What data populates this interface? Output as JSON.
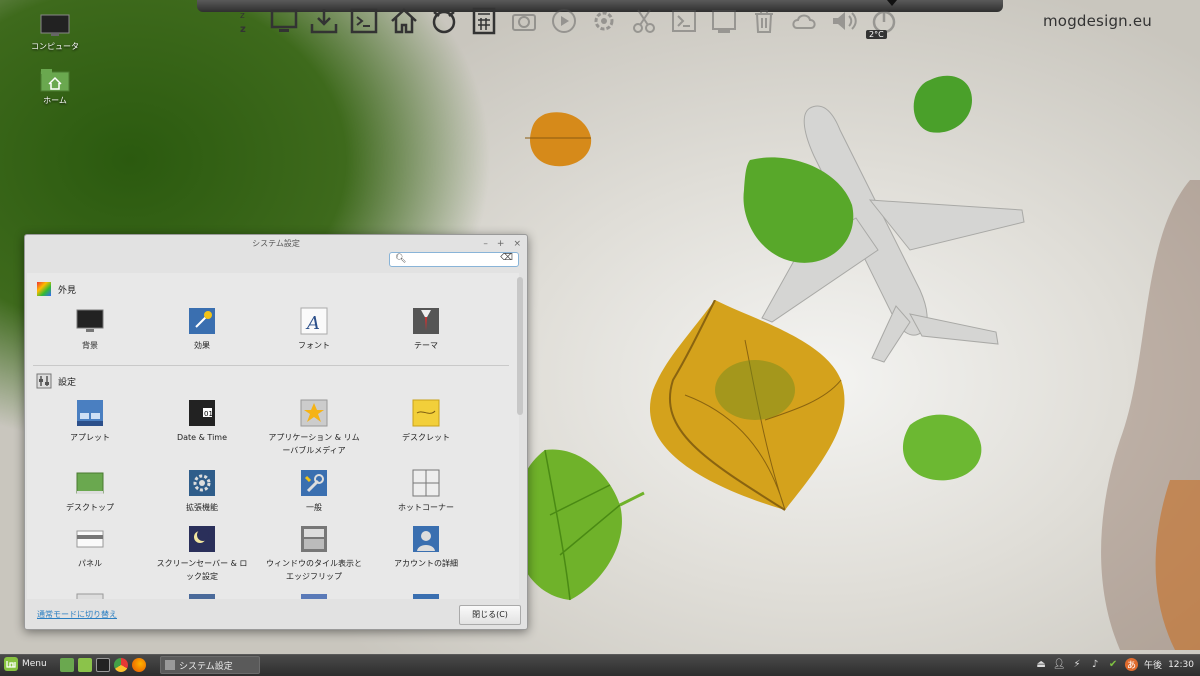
{
  "desktop": {
    "brand": "mogdesign.eu",
    "icons": [
      {
        "label": "コンピュータ",
        "icon": "computer-icon"
      },
      {
        "label": "ホーム",
        "icon": "home-folder-icon"
      }
    ],
    "weather_temp": "2°C"
  },
  "top_dock": {
    "icons": [
      "sleep-icon",
      "monitor-icon",
      "download-icon",
      "terminal-icon",
      "home-icon",
      "browser-icon",
      "calculator-icon",
      "camera-icon",
      "media-icon",
      "settings-icon",
      "scissors-icon",
      "screenshot-icon",
      "photo-icon",
      "trash-icon",
      "weather-icon",
      "volume-icon",
      "power-icon"
    ]
  },
  "window": {
    "title": "システム設定",
    "search": {
      "placeholder": "",
      "value": ""
    },
    "sections": [
      {
        "title": "外見",
        "items": [
          "背景",
          "効果",
          "フォント",
          "テーマ"
        ]
      },
      {
        "title": "設定",
        "items": [
          "アプレット",
          "Date & Time",
          "アプリケーション & リム\nーバブルメディア",
          "デスクレット",
          "デスクトップ",
          "拡張機能",
          "一般",
          "ホットコーナー",
          "パネル",
          "スクリーンセーバー & ロ\nック設定",
          "ウィンドウのタイル表示と\nエッジフリップ",
          "アカウントの詳細"
        ]
      }
    ],
    "footer_link": "通常モードに切り替え",
    "close_button": "閉じる(C)"
  },
  "taskbar": {
    "menu_label": "Menu",
    "task_label": "システム設定",
    "ime_label": "あ",
    "ampm": "午後",
    "clock": "12:30"
  }
}
